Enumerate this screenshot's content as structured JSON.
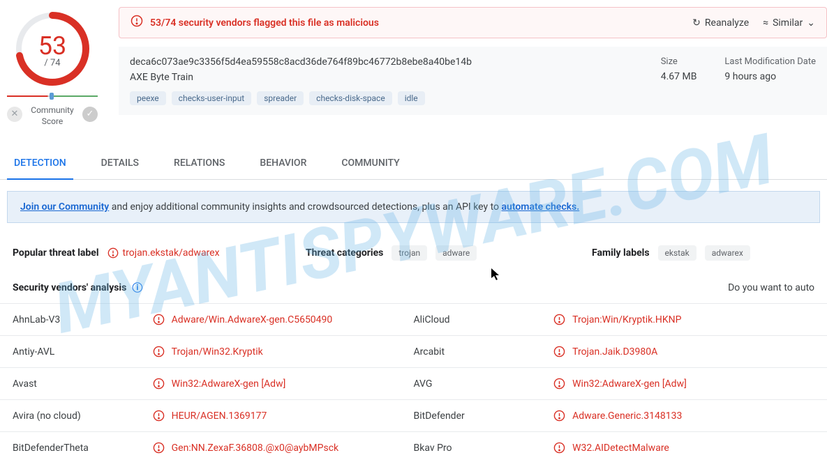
{
  "score": {
    "value": "53",
    "total": "/ 74",
    "community_label": "Community\nScore"
  },
  "alert": {
    "text": "53/74 security vendors flagged this file as malicious",
    "reanalyze": "Reanalyze",
    "similar": "Similar"
  },
  "file": {
    "hash": "deca6c073ae9c3356f5d4ea59558c8acd36de764f89bc46772b8ebe8a40be14b",
    "name": "AXE Byte Train",
    "tags": [
      "peexe",
      "checks-user-input",
      "spreader",
      "checks-disk-space",
      "idle"
    ]
  },
  "meta": {
    "size_label": "Size",
    "size_value": "4.67 MB",
    "date_label": "Last Modification Date",
    "date_value": "9 hours ago"
  },
  "tabs": {
    "detection": "DETECTION",
    "details": "DETAILS",
    "relations": "RELATIONS",
    "behavior": "BEHAVIOR",
    "community": "COMMUNITY"
  },
  "banner": {
    "join": "Join our Community",
    "middle": " and enjoy additional community insights and crowdsourced detections, plus an API key to ",
    "automate": "automate checks."
  },
  "labels": {
    "popular_title": "Popular threat label",
    "popular_value": "trojan.ekstak/adwarex",
    "threat_cat_title": "Threat categories",
    "threat_cats": [
      "trojan",
      "adware"
    ],
    "family_title": "Family labels",
    "families": [
      "ekstak",
      "adwarex"
    ]
  },
  "analysis": {
    "title": "Security vendors' analysis",
    "auto_text": "Do you want to auto"
  },
  "vendors": [
    {
      "name1": "AhnLab-V3",
      "detect1": "Adware/Win.AdwareX-gen.C5650490",
      "name2": "AliCloud",
      "detect2": "Trojan:Win/Kryptik.HKNP"
    },
    {
      "name1": "Antiy-AVL",
      "detect1": "Trojan/Win32.Kryptik",
      "name2": "Arcabit",
      "detect2": "Trojan.Jaik.D3980A"
    },
    {
      "name1": "Avast",
      "detect1": "Win32:AdwareX-gen [Adw]",
      "name2": "AVG",
      "detect2": "Win32:AdwareX-gen [Adw]"
    },
    {
      "name1": "Avira (no cloud)",
      "detect1": "HEUR/AGEN.1369177",
      "name2": "BitDefender",
      "detect2": "Adware.Generic.3148133"
    },
    {
      "name1": "BitDefenderTheta",
      "detect1": "Gen:NN.ZexaF.36808.@x0@aybMPsck",
      "name2": "Bkav Pro",
      "detect2": "W32.AIDetectMalware"
    }
  ]
}
